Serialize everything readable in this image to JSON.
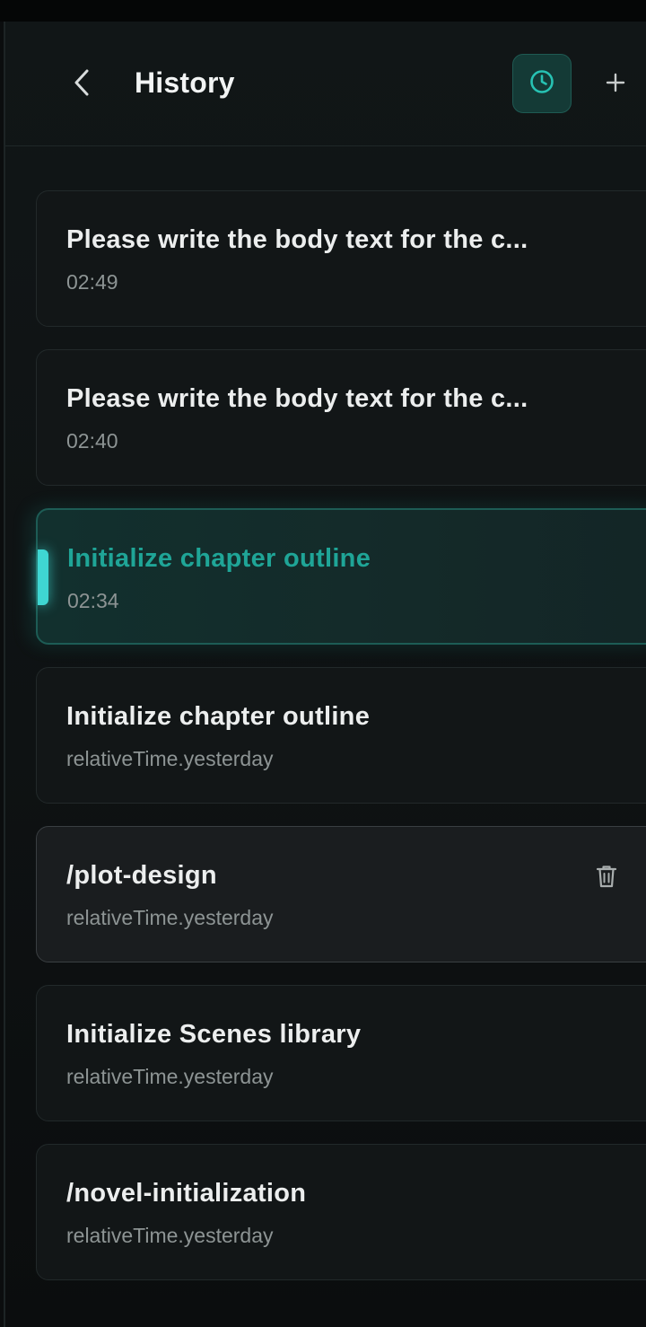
{
  "header": {
    "title": "History",
    "back_icon": "chevron-left-icon",
    "history_icon": "clock-icon",
    "new_icon": "plus-icon"
  },
  "colors": {
    "accent": "#1fa597",
    "accent_bar": "#3fd6d2",
    "history_button_bg": "#143a36"
  },
  "sessions": [
    {
      "title": "Please write the body text for the c...",
      "time": "02:49"
    },
    {
      "title": "Please write the body text for the c...",
      "time": "02:40"
    },
    {
      "title": "Initialize chapter outline",
      "time": "02:34",
      "state": "active"
    },
    {
      "title": "Initialize chapter outline",
      "time": "relativeTime.yesterday"
    },
    {
      "title": "/plot-design",
      "time": "relativeTime.yesterday",
      "state": "hover",
      "action_icon": "trash-icon"
    },
    {
      "title": "Initialize Scenes library",
      "time": "relativeTime.yesterday"
    },
    {
      "title": "/novel-initialization",
      "time": "relativeTime.yesterday"
    }
  ]
}
